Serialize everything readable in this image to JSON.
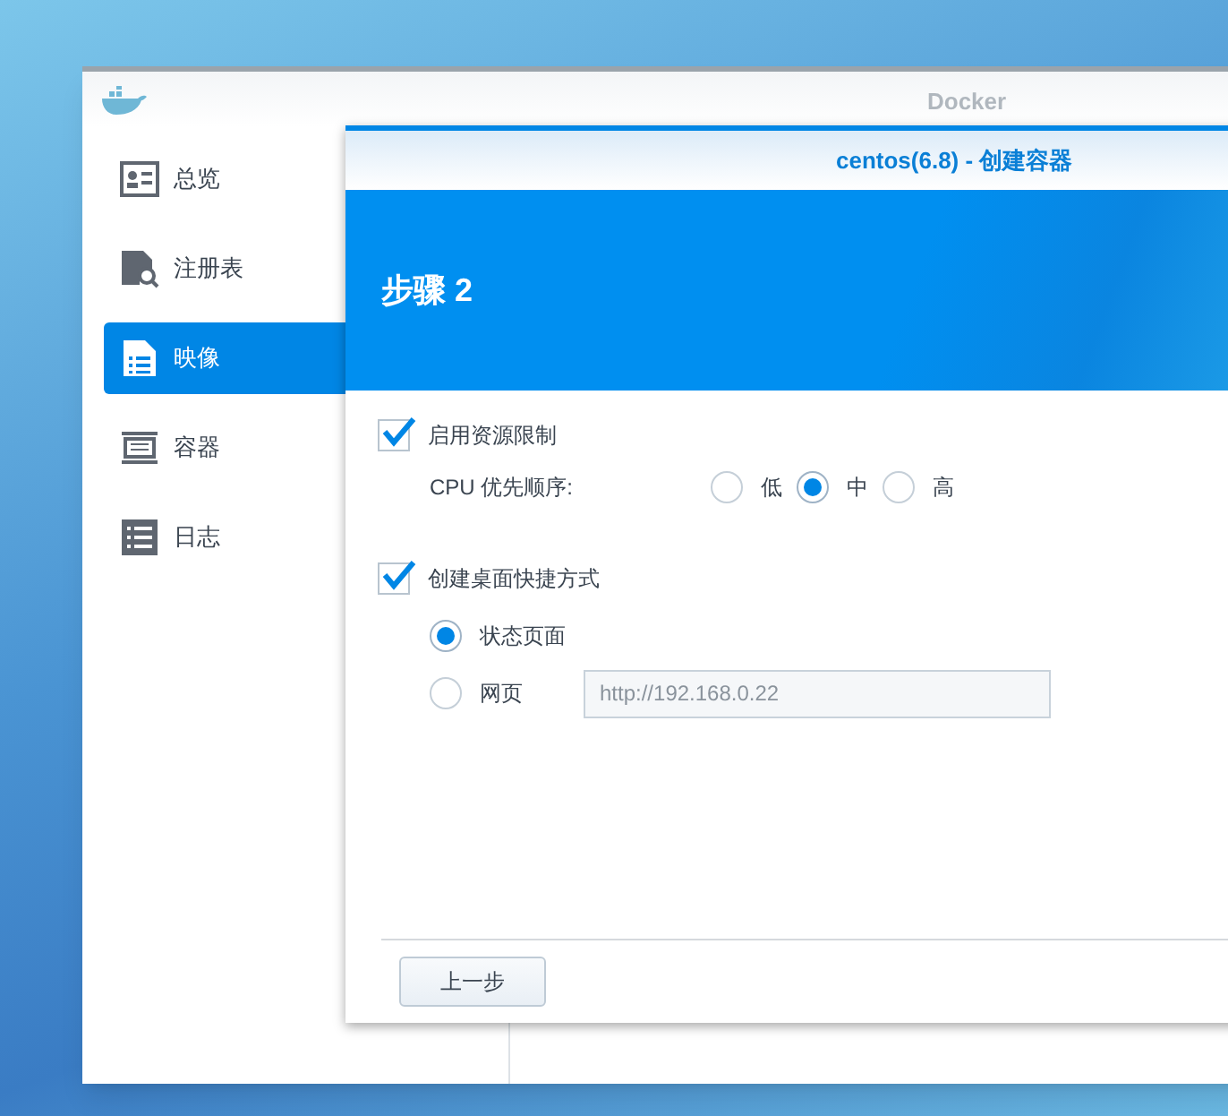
{
  "window": {
    "title": "Docker"
  },
  "sidebar": {
    "items": [
      {
        "label": "总览",
        "selected": false
      },
      {
        "label": "注册表",
        "selected": false
      },
      {
        "label": "映像",
        "selected": true
      },
      {
        "label": "容器",
        "selected": false
      },
      {
        "label": "日志",
        "selected": false
      }
    ]
  },
  "dialog": {
    "title": "centos(6.8) - 创建容器",
    "step": "步骤 2",
    "resource_limit": {
      "label": "启用资源限制",
      "checked": true,
      "cpu_label": "CPU 优先顺序:",
      "options": [
        {
          "label": "低",
          "selected": false
        },
        {
          "label": "中",
          "selected": true
        },
        {
          "label": "高",
          "selected": false
        }
      ]
    },
    "shortcut": {
      "label": "创建桌面快捷方式",
      "checked": true,
      "options": [
        {
          "label": "状态页面",
          "selected": true
        },
        {
          "label": "网页",
          "selected": false,
          "value": "http://192.168.0.22"
        }
      ]
    },
    "buttons": [
      "上一步"
    ]
  }
}
